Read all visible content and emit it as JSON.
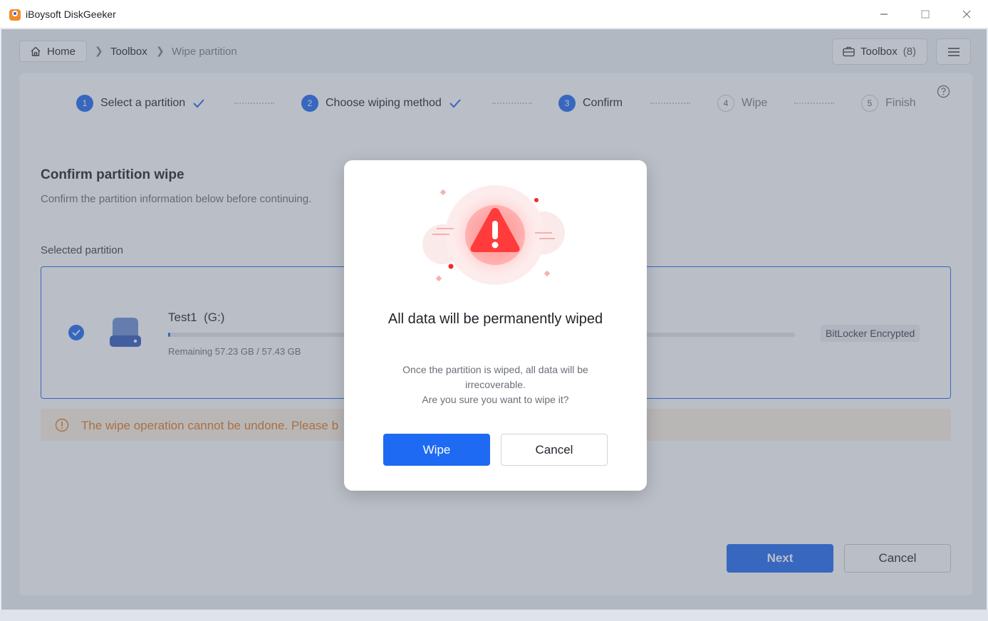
{
  "window": {
    "title": "iBoysoft DiskGeeker"
  },
  "breadcrumb": {
    "home": "Home",
    "items": [
      "Toolbox",
      "Wipe partition"
    ]
  },
  "header": {
    "toolbox_label": "Toolbox",
    "toolbox_count": "(8)"
  },
  "steps": [
    {
      "num": "1",
      "label": "Select a partition",
      "state": "done"
    },
    {
      "num": "2",
      "label": "Choose wiping method",
      "state": "done"
    },
    {
      "num": "3",
      "label": "Confirm",
      "state": "active"
    },
    {
      "num": "4",
      "label": "Wipe",
      "state": "pending"
    },
    {
      "num": "5",
      "label": "Finish",
      "state": "pending"
    }
  ],
  "content": {
    "title": "Confirm partition wipe",
    "subtitle": "Confirm the partition information below before continuing.",
    "selected_label": "Selected partition",
    "partition": {
      "name": "Test1",
      "letter": "(G:)",
      "remaining": "Remaining 57.23 GB / 57.43 GB",
      "tag": "BitLocker Encrypted",
      "used_fraction": 0.0035
    },
    "warning": "The wipe operation cannot be undone. Please b"
  },
  "footer": {
    "next": "Next",
    "cancel": "Cancel"
  },
  "dialog": {
    "title": "All data will be permanently wiped",
    "body_line1": "Once the partition is wiped, all data will be irrecoverable.",
    "body_line2": "Are you sure you want to wipe it?",
    "confirm": "Wipe",
    "cancel": "Cancel"
  },
  "colors": {
    "accent": "#1e6af2",
    "warning": "#e07a1f",
    "danger": "#f03a3a"
  }
}
